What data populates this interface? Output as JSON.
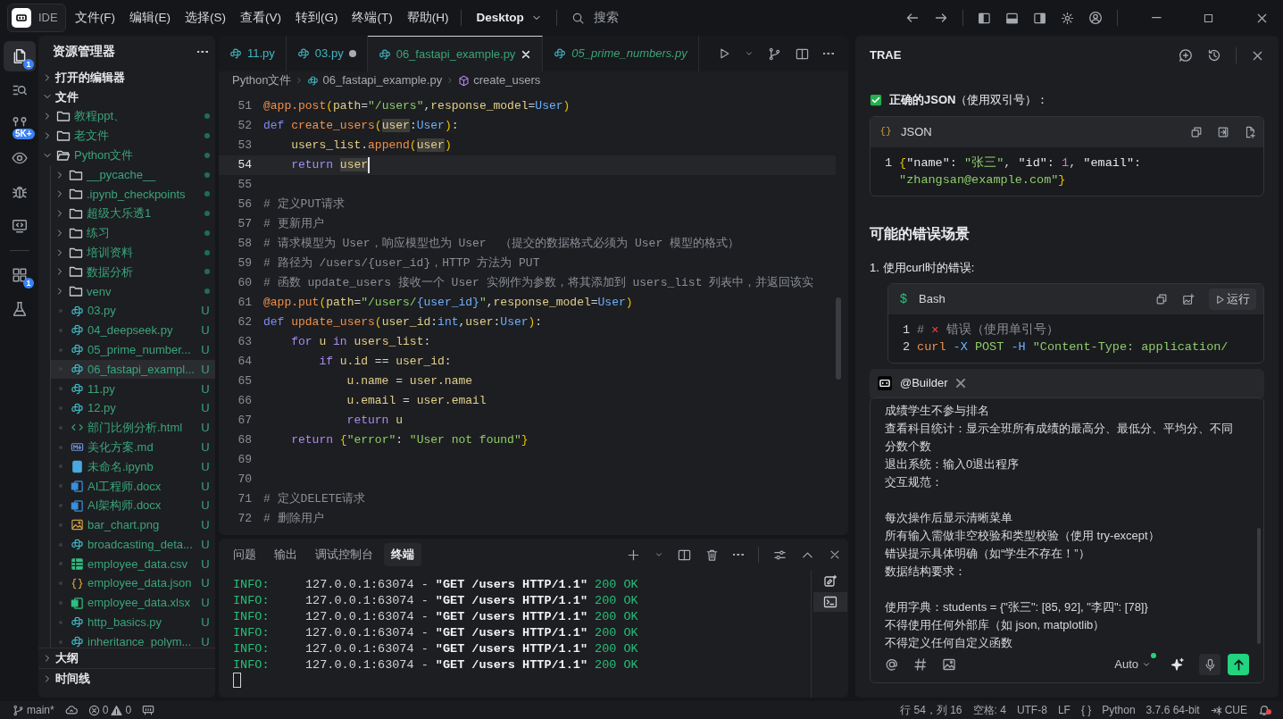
{
  "titlebar": {
    "app": "IDE",
    "menu": [
      "文件(F)",
      "编辑(E)",
      "选择(S)",
      "查看(V)",
      "转到(G)",
      "终端(T)",
      "帮助(H)"
    ],
    "workspace": "Desktop",
    "search": {
      "placeholder": "搜索"
    }
  },
  "activity_bar": {
    "groups": [
      {
        "items": [
          {
            "badge": "1",
            "selected": true
          },
          {
            "selected": false
          },
          {
            "badge": "5K+",
            "selected": false
          },
          {
            "selected": false
          },
          {
            "selected": false
          },
          {
            "selected": false
          }
        ]
      },
      {
        "items": [
          {
            "badge": "1",
            "selected": false
          },
          {
            "selected": false
          }
        ]
      }
    ]
  },
  "sidebar": {
    "title": "资源管理器",
    "sections": [
      {
        "label": "打开的编辑器",
        "expanded": false
      },
      {
        "label": "文件",
        "expanded": true,
        "children": [
          {
            "name": "教程ppt、",
            "kind": "folder",
            "expanded": false,
            "changes": true
          },
          {
            "name": "老文件",
            "kind": "folder",
            "expanded": false,
            "changes": true
          },
          {
            "name": "Python文件",
            "kind": "folder",
            "expanded": true,
            "changes": true,
            "children": [
              {
                "name": "__pycache__",
                "kind": "folder",
                "expanded": false,
                "changes": true
              },
              {
                "name": ".ipynb_checkpoints",
                "kind": "folder",
                "expanded": false,
                "changes": true
              },
              {
                "name": "超级大乐透1",
                "kind": "folder",
                "expanded": false,
                "changes": true
              },
              {
                "name": "练习",
                "kind": "folder",
                "expanded": false,
                "changes": true
              },
              {
                "name": "培训资料",
                "kind": "folder",
                "expanded": false,
                "changes": true
              },
              {
                "name": "数据分析",
                "kind": "folder",
                "expanded": false,
                "changes": true
              },
              {
                "name": "venv",
                "kind": "folder",
                "expanded": false,
                "changes": true
              },
              {
                "name": "03.py",
                "kind": "python",
                "status": "U",
                "selected": false
              },
              {
                "name": "04_deepseek.py",
                "kind": "python",
                "status": "U",
                "selected": false
              },
              {
                "name": "05_prime_number...",
                "kind": "python",
                "status": "U",
                "selected": false
              },
              {
                "name": "06_fastapi_exampl...",
                "kind": "python",
                "status": "U",
                "selected": true
              },
              {
                "name": "11.py",
                "kind": "python",
                "status": "U",
                "selected": false
              },
              {
                "name": "12.py",
                "kind": "python",
                "status": "U",
                "selected": false
              },
              {
                "name": "部门比例分析.html",
                "kind": "html",
                "status": "U",
                "selected": false
              },
              {
                "name": "美化方案.md",
                "kind": "markdown",
                "status": "U",
                "selected": false
              },
              {
                "name": "未命名.ipynb",
                "kind": "notebook",
                "status": "U",
                "selected": false
              },
              {
                "name": "AI工程师.docx",
                "kind": "word",
                "status": "U",
                "selected": false
              },
              {
                "name": "AI架构师.docx",
                "kind": "word",
                "status": "U",
                "selected": false
              },
              {
                "name": "bar_chart.png",
                "kind": "image",
                "status": "U",
                "selected": false
              },
              {
                "name": "broadcasting_deta...",
                "kind": "python",
                "status": "U",
                "selected": false
              },
              {
                "name": "employee_data.csv",
                "kind": "csv",
                "status": "U",
                "selected": false
              },
              {
                "name": "employee_data.json",
                "kind": "json",
                "status": "U",
                "selected": false
              },
              {
                "name": "employee_data.xlsx",
                "kind": "excel",
                "status": "U",
                "selected": false
              },
              {
                "name": "http_basics.py",
                "kind": "python",
                "status": "U",
                "selected": false
              },
              {
                "name": "inheritance_polym...",
                "kind": "python",
                "status": "U",
                "selected": false
              }
            ]
          }
        ]
      },
      {
        "label": "大纲",
        "expanded": false
      },
      {
        "label": "时间线",
        "expanded": false
      }
    ]
  },
  "editor": {
    "tabs": [
      {
        "label": "11.py",
        "selected": false,
        "modified": false,
        "preview": false
      },
      {
        "label": "03.py",
        "selected": false,
        "modified": true,
        "preview": false
      },
      {
        "label": "06_fastapi_example.py",
        "selected": true,
        "modified": false,
        "preview": false
      },
      {
        "label": "05_prime_numbers.py",
        "selected": false,
        "modified": false,
        "preview": true
      }
    ],
    "breadcrumb": [
      "Python文件",
      "06_fastapi_example.py",
      "create_users"
    ],
    "lines": [
      {
        "n": "51",
        "current": false,
        "tokens": [
          {
            "text": "@app.post",
            "kind": "fn"
          },
          {
            "text": "(",
            "kind": "br"
          },
          {
            "text": "path",
            "kind": "id"
          },
          {
            "text": "=",
            "kind": "op"
          },
          {
            "text": "\"/users\"",
            "kind": "str"
          },
          {
            "text": ",",
            "kind": "op"
          },
          {
            "text": "response_model",
            "kind": "id"
          },
          {
            "text": "=",
            "kind": "op"
          },
          {
            "text": "User",
            "kind": "cls"
          },
          {
            "text": ")",
            "kind": "br"
          }
        ]
      },
      {
        "n": "52",
        "current": false,
        "tokens": [
          {
            "text": "def ",
            "kind": "kw"
          },
          {
            "text": "create_users",
            "kind": "fn"
          },
          {
            "text": "(",
            "kind": "br"
          },
          {
            "text": "user",
            "kind": "hl"
          },
          {
            "text": ":",
            "kind": "op"
          },
          {
            "text": "User",
            "kind": "cls"
          },
          {
            "text": ")",
            "kind": "br"
          },
          {
            "text": ":",
            "kind": "op"
          }
        ]
      },
      {
        "n": "53",
        "current": false,
        "tokens": [
          {
            "text": "    users_list",
            "kind": "id"
          },
          {
            "text": ".",
            "kind": "op"
          },
          {
            "text": "append",
            "kind": "fn"
          },
          {
            "text": "(",
            "kind": "br"
          },
          {
            "text": "user",
            "kind": "hl"
          },
          {
            "text": ")",
            "kind": "br"
          }
        ]
      },
      {
        "n": "54",
        "current": true,
        "tokens": [
          {
            "text": "    return ",
            "kind": "kw2"
          },
          {
            "text": "user",
            "kind": "hl"
          }
        ]
      },
      {
        "n": "55",
        "current": false
      },
      {
        "n": "56",
        "current": false,
        "tokens": [
          {
            "text": "# 定义PUT请求",
            "kind": "cm"
          }
        ]
      },
      {
        "n": "57",
        "current": false,
        "tokens": [
          {
            "text": "# 更新用户",
            "kind": "cm"
          }
        ]
      },
      {
        "n": "58",
        "current": false,
        "tokens": [
          {
            "text": "# 请求模型为 User，响应模型也为 User  （提交的数据格式必须为 User 模型的格式）",
            "kind": "cm"
          }
        ]
      },
      {
        "n": "59",
        "current": false,
        "tokens": [
          {
            "text": "# 路径为 /users/{user_id}，HTTP 方法为 PUT",
            "kind": "cm"
          }
        ]
      },
      {
        "n": "60",
        "current": false,
        "tokens": [
          {
            "text": "# 函数 update_users 接收一个 User 实例作为参数，将其添加到 users_list 列表中，并返回该实",
            "kind": "cm"
          }
        ]
      },
      {
        "n": "61",
        "current": false,
        "tokens": [
          {
            "text": "@app.put",
            "kind": "fn"
          },
          {
            "text": "(",
            "kind": "br"
          },
          {
            "text": "path",
            "kind": "id"
          },
          {
            "text": "=",
            "kind": "op"
          },
          {
            "text": "\"/users/",
            "kind": "str"
          },
          {
            "text": "{user_id}",
            "kind": "cls"
          },
          {
            "text": "\"",
            "kind": "str"
          },
          {
            "text": ",",
            "kind": "op"
          },
          {
            "text": "response_model",
            "kind": "id"
          },
          {
            "text": "=",
            "kind": "op"
          },
          {
            "text": "User",
            "kind": "cls"
          },
          {
            "text": ")",
            "kind": "br"
          }
        ]
      },
      {
        "n": "62",
        "current": false,
        "tokens": [
          {
            "text": "def ",
            "kind": "kw"
          },
          {
            "text": "update_users",
            "kind": "fn"
          },
          {
            "text": "(",
            "kind": "br"
          },
          {
            "text": "user_id",
            "kind": "id"
          },
          {
            "text": ":",
            "kind": "op"
          },
          {
            "text": "int",
            "kind": "cls"
          },
          {
            "text": ",",
            "kind": "op"
          },
          {
            "text": "user",
            "kind": "id"
          },
          {
            "text": ":",
            "kind": "op"
          },
          {
            "text": "User",
            "kind": "cls"
          },
          {
            "text": ")",
            "kind": "br"
          },
          {
            "text": ":",
            "kind": "op"
          }
        ]
      },
      {
        "n": "63",
        "current": false,
        "tokens": [
          {
            "text": "    for",
            "kind": "kw2"
          },
          {
            "text": " u ",
            "kind": "id"
          },
          {
            "text": "in",
            "kind": "kw2"
          },
          {
            "text": " users_list",
            "kind": "id"
          },
          {
            "text": ":",
            "kind": "op"
          }
        ]
      },
      {
        "n": "64",
        "current": false,
        "tokens": [
          {
            "text": "        if",
            "kind": "kw2"
          },
          {
            "text": " u.id ",
            "kind": "id"
          },
          {
            "text": "==",
            "kind": "op"
          },
          {
            "text": " user_id",
            "kind": "id"
          },
          {
            "text": ":",
            "kind": "op"
          }
        ]
      },
      {
        "n": "65",
        "current": false,
        "tokens": [
          {
            "text": "            u.name ",
            "kind": "id"
          },
          {
            "text": "=",
            "kind": "op"
          },
          {
            "text": " user.name",
            "kind": "id"
          }
        ]
      },
      {
        "n": "66",
        "current": false,
        "tokens": [
          {
            "text": "            u.email ",
            "kind": "id"
          },
          {
            "text": "=",
            "kind": "op"
          },
          {
            "text": " user.email",
            "kind": "id"
          }
        ]
      },
      {
        "n": "67",
        "current": false,
        "tokens": [
          {
            "text": "            return",
            "kind": "kw2"
          },
          {
            "text": " u",
            "kind": "id"
          }
        ]
      },
      {
        "n": "68",
        "current": false,
        "tokens": [
          {
            "text": "    return ",
            "kind": "kw2"
          },
          {
            "text": "{",
            "kind": "br"
          },
          {
            "text": "\"error\"",
            "kind": "str"
          },
          {
            "text": ": ",
            "kind": "op"
          },
          {
            "text": "\"User not found\"",
            "kind": "str"
          },
          {
            "text": "}",
            "kind": "br"
          }
        ]
      },
      {
        "n": "69",
        "current": false
      },
      {
        "n": "70",
        "current": false
      },
      {
        "n": "71",
        "current": false,
        "tokens": [
          {
            "text": "# 定义DELETE请求",
            "kind": "cm"
          }
        ]
      },
      {
        "n": "72",
        "current": false,
        "tokens": [
          {
            "text": "# 删除用户",
            "kind": "cm"
          }
        ]
      }
    ]
  },
  "panel": {
    "tabs": [
      {
        "label": "问题",
        "selected": false
      },
      {
        "label": "输出",
        "selected": false
      },
      {
        "label": "调试控制台",
        "selected": false
      },
      {
        "label": "终端",
        "selected": true
      }
    ],
    "lines": [
      {
        "tag": "INFO:",
        "text": "     127.0.0.1:63074 - ",
        "request": "\"GET /users HTTP/1.1\"",
        "status": "200 OK"
      },
      {
        "tag": "INFO:",
        "text": "     127.0.0.1:63074 - ",
        "request": "\"GET /users HTTP/1.1\"",
        "status": "200 OK"
      },
      {
        "tag": "INFO:",
        "text": "     127.0.0.1:63074 - ",
        "request": "\"GET /users HTTP/1.1\"",
        "status": "200 OK"
      },
      {
        "tag": "INFO:",
        "text": "     127.0.0.1:63074 - ",
        "request": "\"GET /users HTTP/1.1\"",
        "status": "200 OK"
      },
      {
        "tag": "INFO:",
        "text": "     127.0.0.1:63074 - ",
        "request": "\"GET /users HTTP/1.1\"",
        "status": "200 OK"
      },
      {
        "tag": "INFO:",
        "text": "     127.0.0.1:63074 - ",
        "request": "\"GET /users HTTP/1.1\"",
        "status": "200 OK"
      }
    ]
  },
  "assistant": {
    "title": "TRAE",
    "blocks": [
      {
        "kind": "check",
        "text": "**正确的JSON**（使用双引号）："
      },
      {
        "kind": "code",
        "lang": "JSON",
        "lang_icon": "{}",
        "indent": false,
        "run": false,
        "lines": [
          {
            "n": "1",
            "tokens": [
              {
                "text": "{",
                "kind": "br"
              },
              {
                "text": "\"name\"",
                "kind": "key"
              },
              {
                "text": ": ",
                "kind": "op"
              },
              {
                "text": "\"张三\"",
                "kind": "str"
              },
              {
                "text": ", ",
                "kind": "op"
              },
              {
                "text": "\"id\"",
                "kind": "key"
              },
              {
                "text": ": ",
                "kind": "op"
              },
              {
                "text": "1",
                "kind": "num"
              },
              {
                "text": ", ",
                "kind": "op"
              },
              {
                "text": "\"email\"",
                "kind": "key"
              },
              {
                "text": ":",
                "kind": "op"
              },
              {
                "text": " \"zhangsan@example.com\"",
                "kind": "str"
              },
              {
                "text": "}",
                "kind": "br"
              }
            ]
          }
        ]
      },
      {
        "kind": "heading",
        "text": "可能的错误场景"
      },
      {
        "kind": "item",
        "number": "1.",
        "text": "使用curl时的错误:"
      },
      {
        "kind": "code",
        "lang": "Bash",
        "lang_icon": "$",
        "indent": true,
        "run": true,
        "run_label": "运行",
        "lines": [
          {
            "n": "1",
            "tokens": [
              {
                "text": "# ",
                "kind": "cm"
              },
              {
                "text": "✕",
                "kind": "err"
              },
              {
                "text": " 错误（使用单引号）",
                "kind": "cm"
              }
            ]
          },
          {
            "n": "2",
            "tokens": [
              {
                "text": "curl",
                "kind": "fn"
              },
              {
                "text": " -X ",
                "kind": "flag"
              },
              {
                "text": "POST",
                "kind": "str"
              },
              {
                "text": " -H ",
                "kind": "flag"
              },
              {
                "text": "\"Content-Type: application/",
                "kind": "str"
              }
            ]
          }
        ]
      }
    ],
    "composer": {
      "mention": "@Builder",
      "paragraphs": [
        [
          "成绩学生不参与排名",
          "查看科目统计：显示全班所有成绩的最高分、最低分、平均分、不同分数个数",
          "退出系统：输入0退出程序",
          "交互规范："
        ],
        [
          "每次操作后显示清晰菜单",
          "所有输入需做非空校验和类型校验（使用 try-except）",
          "错误提示具体明确（如“学生不存在！”）",
          "数据结构要求："
        ],
        [
          "使用字典：students = {\"张三\": [85, 92], \"李四\": [78]}",
          "不得使用任何外部库（如 json, matplotlib）",
          "不得定义任何自定义函数"
        ]
      ],
      "model": "Auto"
    }
  },
  "status_bar": {
    "branch": "main*",
    "errors": "0",
    "warnings": "0",
    "items": [
      "行 54，列 16",
      "空格: 4",
      "UTF-8",
      "LF",
      "{ }",
      "Python",
      "3.7.6 64-bit",
      "CUE"
    ]
  }
}
